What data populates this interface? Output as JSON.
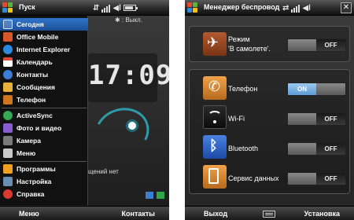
{
  "left": {
    "title": "Пуск",
    "bluetooth_status": ": Выкл.",
    "clock": "17:09",
    "status_text": "щений нет",
    "menu": [
      {
        "label": "Сегодня",
        "selected": true,
        "color": "#2f76c9"
      },
      {
        "label": "Office Mobile",
        "color": "#d9552a"
      },
      {
        "label": "Internet Explorer",
        "color": "#2a8be0"
      },
      {
        "label": "Календарь",
        "color": "#e04b3a"
      },
      {
        "label": "Контакты",
        "color": "#3d7dd6"
      },
      {
        "label": "Сообщения",
        "color": "#e8b13a"
      },
      {
        "label": "Телефон",
        "color": "#d0751f"
      },
      {
        "label": "ActiveSync",
        "color": "#34a853"
      },
      {
        "label": "Фото и видео",
        "color": "#8a5cd1"
      },
      {
        "label": "Камера",
        "color": "#7a7a7a"
      },
      {
        "label": "Меню",
        "color": "#c9c9c9"
      },
      {
        "label": "Программы",
        "color": "#f0a020"
      },
      {
        "label": "Настройка",
        "color": "#6a8fb5"
      },
      {
        "label": "Справка",
        "color": "#d93b2f"
      }
    ],
    "softkeys": {
      "left": "Меню",
      "right": "Контакты"
    }
  },
  "right": {
    "title": "Менеджер беспровод",
    "close": "✕",
    "airplane": {
      "label_line1": "Режим",
      "label_line2": "'В самолете'.",
      "on": "",
      "off": "OFF"
    },
    "services": [
      {
        "label": "Телефон",
        "state": "on",
        "on": "ON",
        "off": "",
        "icon": "phone-icon",
        "color": "#d98a2b"
      },
      {
        "label": "Wi-Fi",
        "state": "off",
        "on": "",
        "off": "OFF",
        "icon": "wifi-icon",
        "color": "#1a1a1a"
      },
      {
        "label": "Bluetooth",
        "state": "off",
        "on": "",
        "off": "OFF",
        "icon": "bluetooth-icon",
        "color": "#2a5fc4"
      },
      {
        "label": "Сервис данных",
        "state": "off",
        "on": "",
        "off": "OFF",
        "icon": "data-service-icon",
        "color": "#d98a2b"
      }
    ],
    "softkeys": {
      "left": "Выход",
      "right": "Установка"
    }
  }
}
